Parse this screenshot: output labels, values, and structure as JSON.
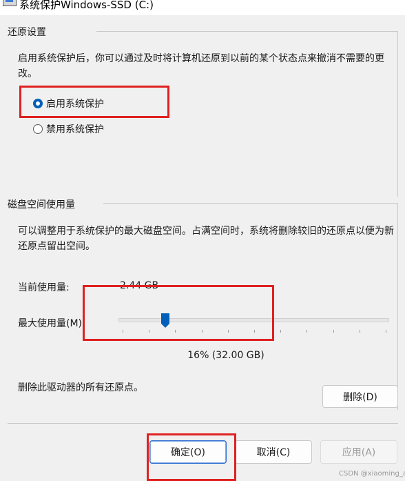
{
  "window": {
    "title": "系统保护Windows-SSD (C:)"
  },
  "restore": {
    "group_title": "还原设置",
    "description": "启用系统保护后，你可以通过及时将计算机还原到以前的某个状态点来撤消不需要的更改。",
    "options": [
      {
        "label": "启用系统保护",
        "selected": true
      },
      {
        "label": "禁用系统保护",
        "selected": false
      }
    ]
  },
  "disk": {
    "group_title": "磁盘空间使用量",
    "description": "可以调整用于系统保护的最大磁盘空间。占满空间时，系统将删除较旧的还原点以便为新还原点留出空间。",
    "current_label": "当前使用量:",
    "current_value": "2.44 GB",
    "max_label": "最大使用量(M):",
    "slider_value_percent": 16,
    "slider_readout": "16% (32.00 GB)",
    "delete_text": "删除此驱动器的所有还原点。",
    "delete_button": "删除(D)"
  },
  "buttons": {
    "ok": "确定(O)",
    "cancel": "取消(C)",
    "apply": "应用(A)"
  },
  "colors": {
    "accent": "#005fb8",
    "highlight_box": "#e02020"
  },
  "watermark": "CSDN @xiaoming_a"
}
